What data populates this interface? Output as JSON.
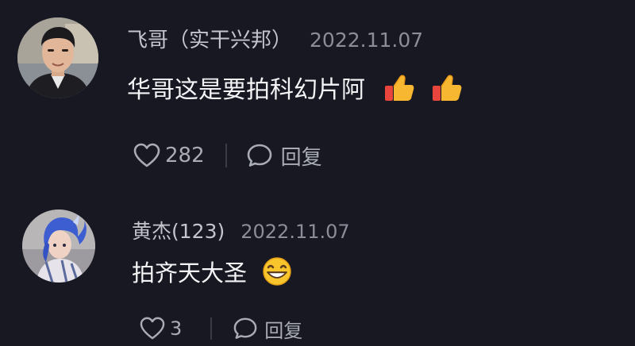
{
  "comments": [
    {
      "username": "飞哥（实干兴邦）",
      "date": "2022.11.07",
      "text": "华哥这是要拍科幻片阿",
      "emojis": [
        "thumbs-up-icon",
        "thumbs-up-icon"
      ],
      "likes": "282",
      "reply_label": "回复"
    },
    {
      "username": "黄杰(123)",
      "date": "2022.11.07",
      "text": "拍齐天大圣",
      "emojis": [
        "grinning-face-icon"
      ],
      "likes": "3",
      "reply_label": "回复"
    }
  ],
  "colors": {
    "background": "#171822",
    "username": "#c3c4cc",
    "date": "#8b8d99",
    "text": "#f4f4f6",
    "action": "#a9abb5"
  }
}
